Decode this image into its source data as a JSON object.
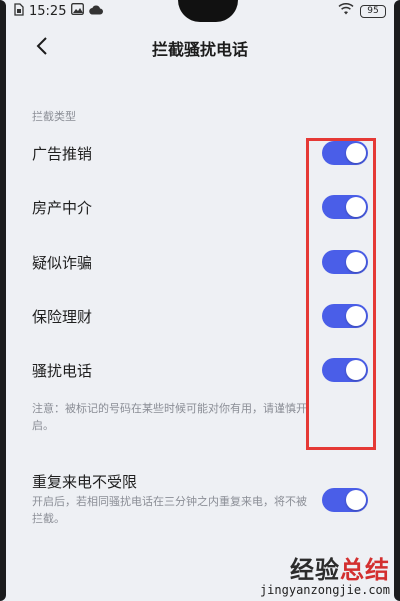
{
  "status_bar": {
    "time": "15:25",
    "battery": "95",
    "left_icons": [
      "sim-icon",
      "image-icon",
      "cloud-icon"
    ],
    "right_icons": [
      "wifi-icon",
      "battery-icon"
    ]
  },
  "nav": {
    "back_icon": "chevron-left-icon",
    "title": "拦截骚扰电话"
  },
  "section": {
    "header": "拦截类型",
    "items": [
      {
        "label": "广告推销",
        "enabled": true
      },
      {
        "label": "房产中介",
        "enabled": true
      },
      {
        "label": "疑似诈骗",
        "enabled": true
      },
      {
        "label": "保险理财",
        "enabled": true
      },
      {
        "label": "骚扰电话",
        "enabled": true
      }
    ],
    "note": "注意：被标记的号码在某些时候可能对你有用，请谨慎开启。"
  },
  "repeat_call": {
    "label": "重复来电不受限",
    "enabled": true,
    "description": "开启后，若相同骚扰电话在三分钟之内重复来电，将不被拦截。"
  },
  "watermark": {
    "chinese_prefix": "经验",
    "chinese_suffix": "总结",
    "url": "jingyanzongjie.com"
  },
  "colors": {
    "toggle_on": "#4a5ee8",
    "highlight": "#e53935",
    "background": "#eef0f4"
  }
}
